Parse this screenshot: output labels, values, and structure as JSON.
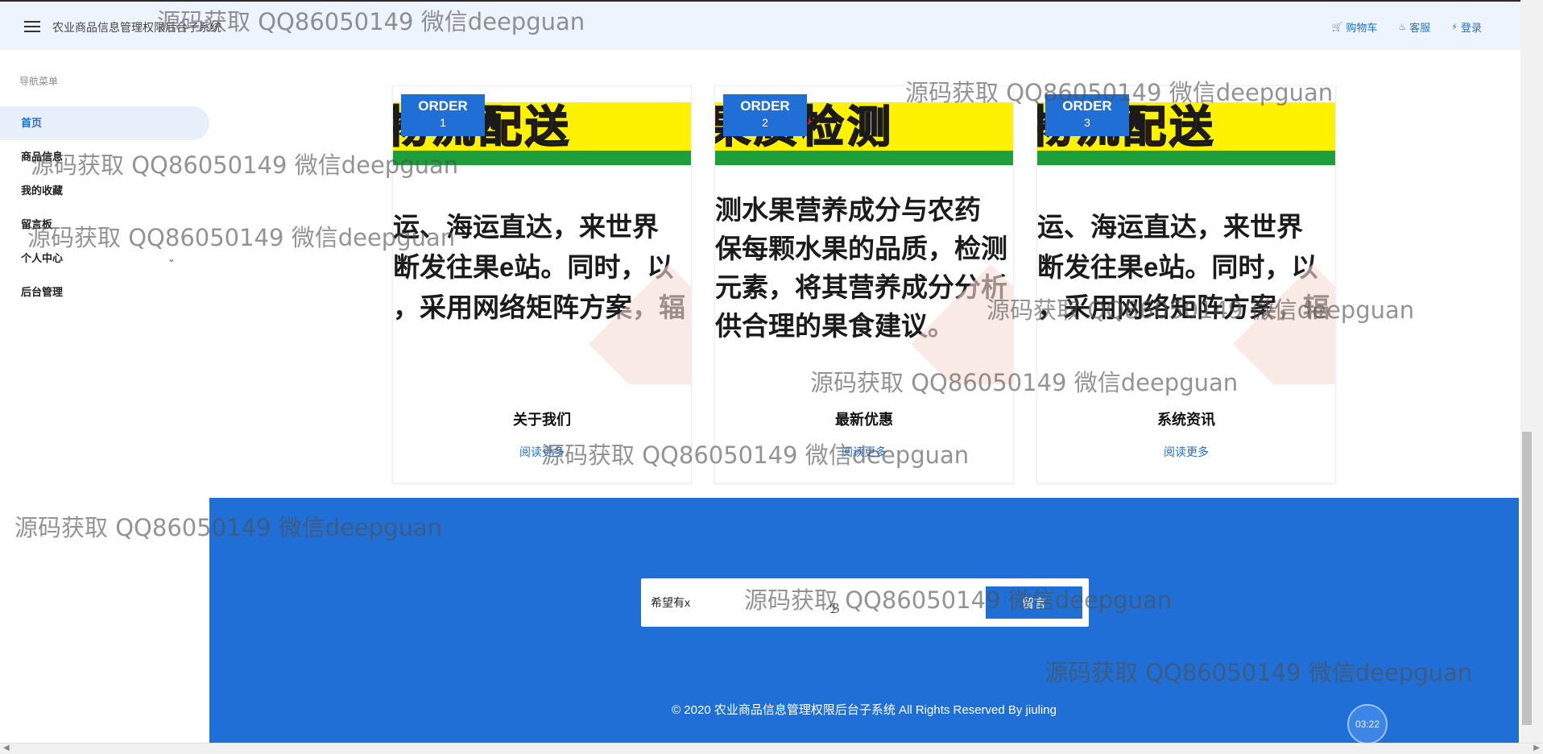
{
  "header": {
    "app_title": "农业商品信息管理权限后台子系统",
    "actions": [
      {
        "label": "购物车",
        "icon": "cart-icon"
      },
      {
        "label": "客服",
        "icon": "bell-icon"
      },
      {
        "label": "登录",
        "icon": "bolt-icon"
      }
    ]
  },
  "sidebar": {
    "header": "导航菜单",
    "items": [
      {
        "label": "首页",
        "active": true
      },
      {
        "label": "商品信息"
      },
      {
        "label": "我的收藏"
      },
      {
        "label": "留言板"
      },
      {
        "label": "个人中心",
        "has_children": true
      },
      {
        "label": "后台管理"
      }
    ]
  },
  "cards": [
    {
      "order_label": "ORDER",
      "order_num": "1",
      "title": "关于我们",
      "link": "阅读更多",
      "image_banner": "物流配送",
      "image_lines": [
        "运、海运直达，来世界",
        "断发往果e站。同时，以",
        "，采用网络矩阵方案，辐"
      ]
    },
    {
      "order_label": "ORDER",
      "order_num": "2",
      "title": "最新优惠",
      "link": "阅读更多",
      "image_banner": "果质检测",
      "image_lines": [
        "测水果营养成分与农药",
        "保每颗水果的品质，检测",
        "元素，将其营养成分分析",
        "供合理的果食建议。"
      ]
    },
    {
      "order_label": "ORDER",
      "order_num": "3",
      "title": "系统资讯",
      "link": "阅读更多",
      "image_banner": "物流配送",
      "image_lines": [
        "运、海运直达，来世界",
        "断发往果e站。同时，以",
        "，采用网络矩阵方案，辐"
      ]
    }
  ],
  "footer": {
    "subscribe_value": "希望有x",
    "subscribe_button": "留言",
    "copyright": "© 2020 农业商品信息管理权限后台子系统 All Rights Reserved By jiuling",
    "timer": "03:22"
  },
  "watermark": "源码获取 QQ86050149 微信deepguan",
  "colors": {
    "primary": "#1f6fd6",
    "topbar_bg": "#eef4fd",
    "active_nav_bg": "#e7effb"
  }
}
